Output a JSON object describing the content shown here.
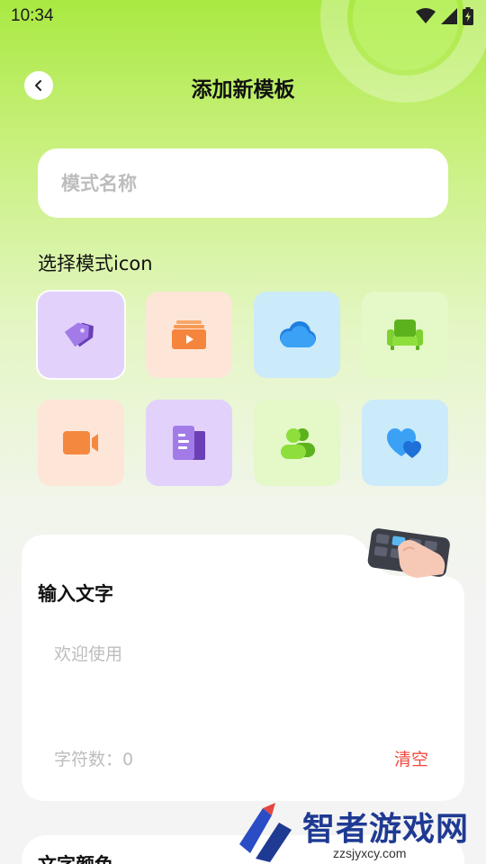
{
  "status_bar": {
    "time": "10:34"
  },
  "header": {
    "title": "添加新模板"
  },
  "template_name": {
    "placeholder": "模式名称"
  },
  "icon_section": {
    "label": "选择模式icon",
    "icons": [
      {
        "name": "tag-icon",
        "bg": "#e2d2fb",
        "selected": true
      },
      {
        "name": "media-folder-icon",
        "bg": "#fde6d8",
        "selected": false
      },
      {
        "name": "cloud-icon",
        "bg": "#cbeafa",
        "selected": false
      },
      {
        "name": "sofa-icon",
        "bg": "#e4f8c8",
        "selected": false
      },
      {
        "name": "video-camera-icon",
        "bg": "#fde6d8",
        "selected": false
      },
      {
        "name": "document-icon",
        "bg": "#e2d2fb",
        "selected": false
      },
      {
        "name": "users-icon",
        "bg": "#e4f8c8",
        "selected": false
      },
      {
        "name": "hearts-icon",
        "bg": "#cbeafa",
        "selected": false
      }
    ]
  },
  "text_card": {
    "title": "输入文字",
    "placeholder": "欢迎使用",
    "char_count": "字符数：0",
    "clear_label": "清空"
  },
  "color_card": {
    "title": "文字颜色"
  },
  "watermark": {
    "text": "智者游戏网",
    "url": "zzsjyxcy.com"
  },
  "colors": {
    "accent_green": "#a9e942",
    "clear_red": "#f0493c",
    "placeholder_gray": "#bdbdbd"
  }
}
